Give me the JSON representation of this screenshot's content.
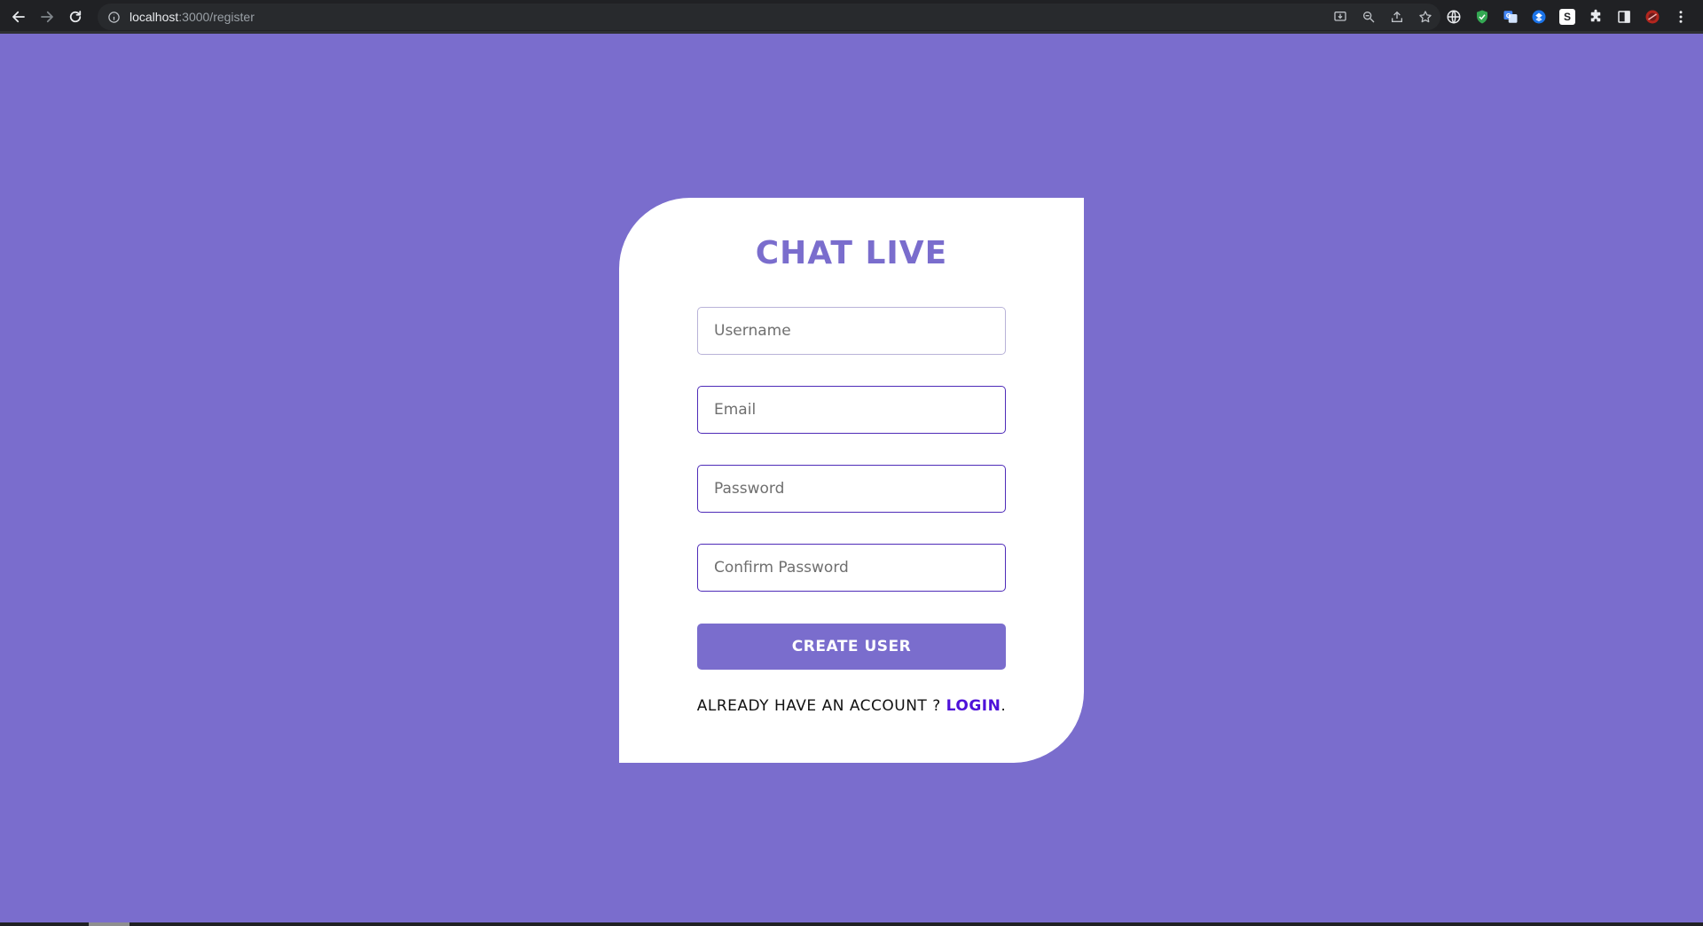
{
  "browser": {
    "url_host": "localhost",
    "url_path": ":3000/register"
  },
  "page": {
    "brand_title": "CHAT LIVE",
    "fields": {
      "username_placeholder": "Username",
      "email_placeholder": "Email",
      "password_placeholder": "Password",
      "confirm_placeholder": "Confirm Password"
    },
    "submit_label": "CREATE USER",
    "login_prompt": "ALREADY HAVE AN ACCOUNT ? ",
    "login_link": "LOGIN",
    "login_suffix": "."
  },
  "colors": {
    "background": "#7a6dcd",
    "card": "#ffffff",
    "accent": "#7a6dcd",
    "field_border": "#4e2bb8",
    "link": "#4e11d9"
  },
  "icons": {
    "back": "arrow-left-icon",
    "forward": "arrow-right-icon",
    "reload": "reload-icon",
    "site_info": "info-icon",
    "install": "install-icon",
    "zoom": "zoom-icon",
    "share": "share-icon",
    "bookmark": "star-icon",
    "extensions": "puzzle-icon",
    "side_panel": "side-panel-icon",
    "menu": "kebab-menu-icon"
  }
}
